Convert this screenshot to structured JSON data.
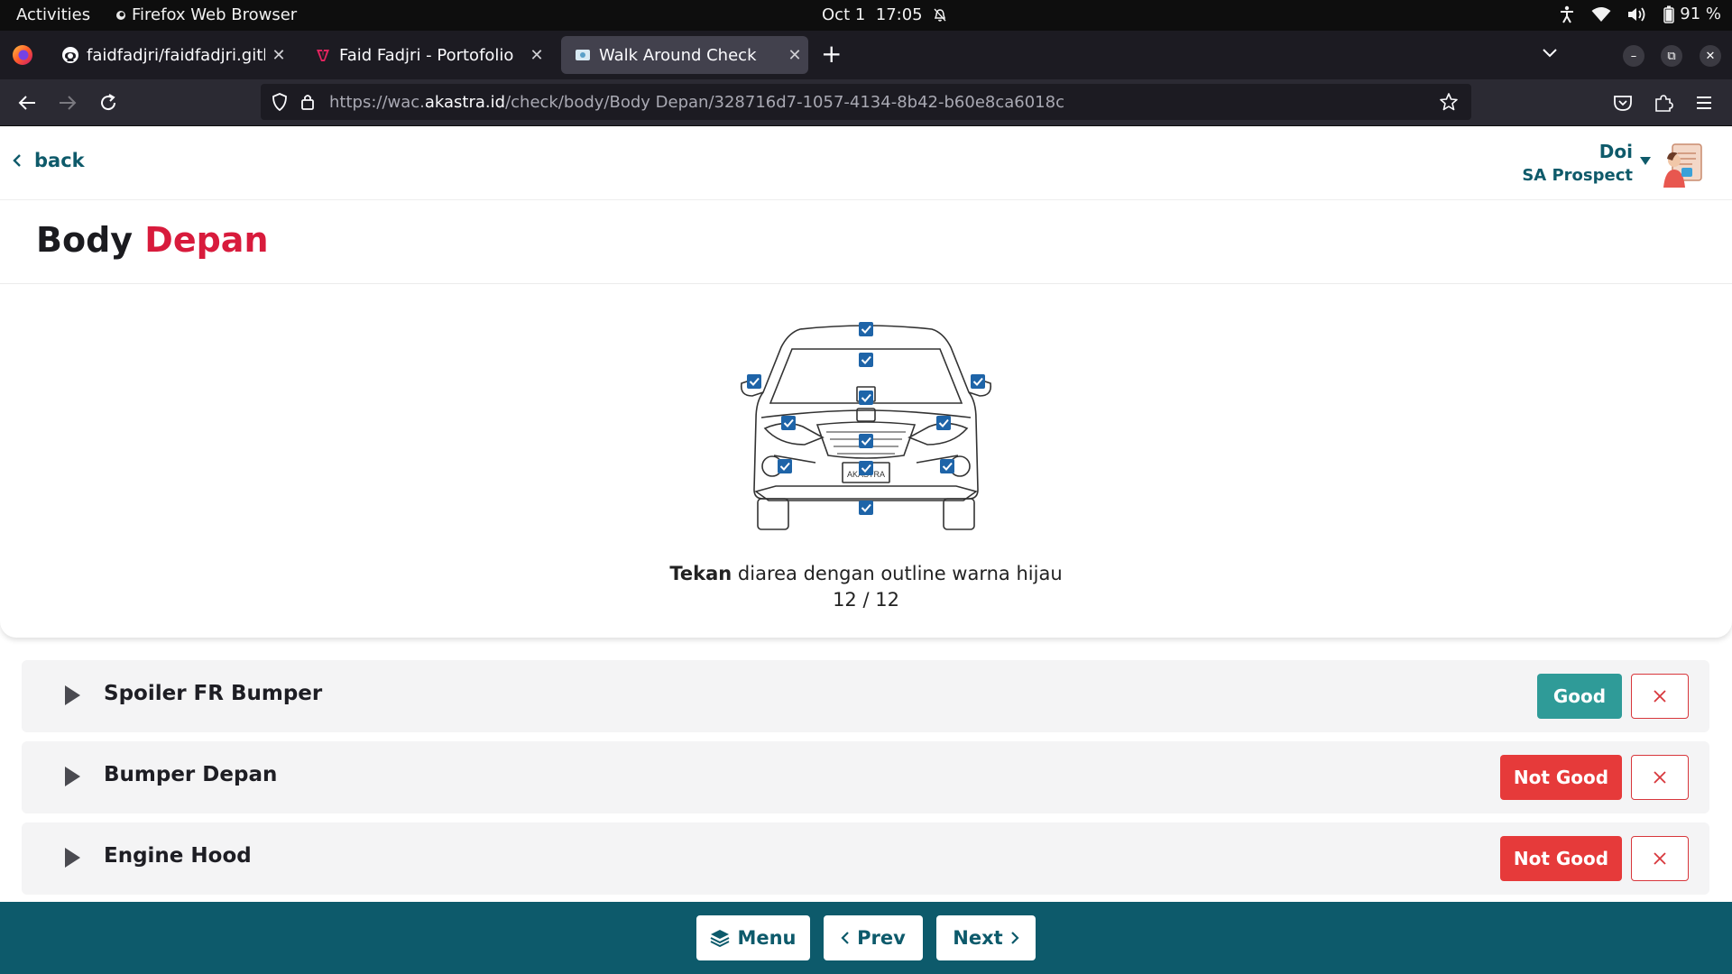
{
  "system_bar": {
    "activities": "Activities",
    "app_name": "Firefox Web Browser",
    "date": "Oct 1",
    "time": "17:05",
    "battery": "91 %"
  },
  "browser": {
    "tabs": [
      {
        "title": "faidfadjri/faidfadjri.github",
        "icon": "github-icon"
      },
      {
        "title": "Faid Fadjri - Portofolio",
        "icon": "portfolio-icon"
      },
      {
        "title": "Walk Around Check",
        "icon": "page-icon",
        "active": true
      }
    ],
    "url_prefix": "https://wac.",
    "url_domain": "akastra.id",
    "url_path": "/check/body/Body Depan/328716d7-1057-4134-8b42-b60e8ca6018c"
  },
  "header": {
    "back_label": "back",
    "user_name": "Doi",
    "user_role": "SA Prospect"
  },
  "title": {
    "part1": "Body",
    "part2": "Depan"
  },
  "diagram": {
    "instruction_bold": "Tekan",
    "instruction_rest": " diarea dengan outline warna hijau",
    "progress": "12 / 12",
    "checked_count": 12,
    "total_count": 12,
    "plate_text": "AKASTRA"
  },
  "items": [
    {
      "name": "Spoiler FR Bumper",
      "status": "Good",
      "status_type": "good"
    },
    {
      "name": "Bumper Depan",
      "status": "Not Good",
      "status_type": "bad"
    },
    {
      "name": "Engine Hood",
      "status": "Not Good",
      "status_type": "bad"
    }
  ],
  "footer": {
    "menu_label": "Menu",
    "prev_label": "Prev",
    "next_label": "Next"
  },
  "colors": {
    "brand_teal": "#0d5a6b",
    "accent_red": "#d81b3c",
    "good": "#2f9b98",
    "not_good": "#e63a3a",
    "check_blue": "#1e64a8"
  }
}
